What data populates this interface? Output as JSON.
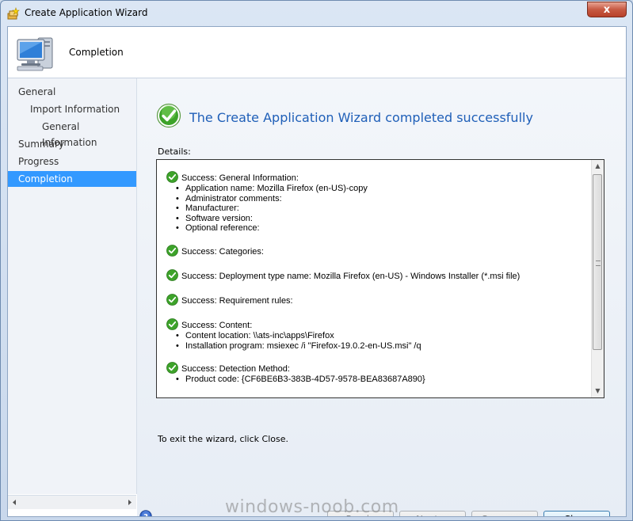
{
  "window": {
    "title": "Create Application Wizard",
    "close_glyph": "x"
  },
  "header": {
    "title": "Completion",
    "icon": "computer-icon"
  },
  "nav": {
    "items": [
      {
        "label": "General",
        "level": 0,
        "selected": false
      },
      {
        "label": "Import Information",
        "level": 1,
        "selected": false
      },
      {
        "label": "General Information",
        "level": 2,
        "selected": false
      },
      {
        "label": "Summary",
        "level": 0,
        "selected": false
      },
      {
        "label": "Progress",
        "level": 0,
        "selected": false
      },
      {
        "label": "Completion",
        "level": 0,
        "selected": true
      }
    ]
  },
  "main": {
    "headline": "The Create Application Wizard completed successfully",
    "details_label": "Details:",
    "exit_text": "To exit the wizard, click Close.",
    "details": [
      {
        "head": "Success: General Information:",
        "bullets": [
          "Application name: Mozilla Firefox (en-US)-copy",
          "Administrator comments:",
          "Manufacturer:",
          "Software version:",
          "Optional reference:"
        ]
      },
      {
        "head": "Success: Categories:",
        "bullets": []
      },
      {
        "head": "Success: Deployment type name: Mozilla Firefox (en-US) - Windows Installer (*.msi file)",
        "bullets": []
      },
      {
        "head": "Success: Requirement rules:",
        "bullets": []
      },
      {
        "head": "Success: Content:",
        "bullets": [
          "Content location: \\\\ats-inc\\apps\\Firefox",
          "Installation program: msiexec /i \"Firefox-19.0.2-en-US.msi\" /q"
        ]
      },
      {
        "head": "Success: Detection Method:",
        "bullets": [
          "Product code: {CF6BE6B3-383B-4D57-9578-BEA83687A890}"
        ]
      }
    ]
  },
  "buttons": {
    "previous": "< Previous",
    "next": "Next >",
    "summary": "Summary",
    "close": "Close"
  },
  "watermark": "windows-noob.com",
  "colors": {
    "selection": "#3399ff",
    "headline": "#1f5fb8",
    "success_green": "#3da32a"
  }
}
